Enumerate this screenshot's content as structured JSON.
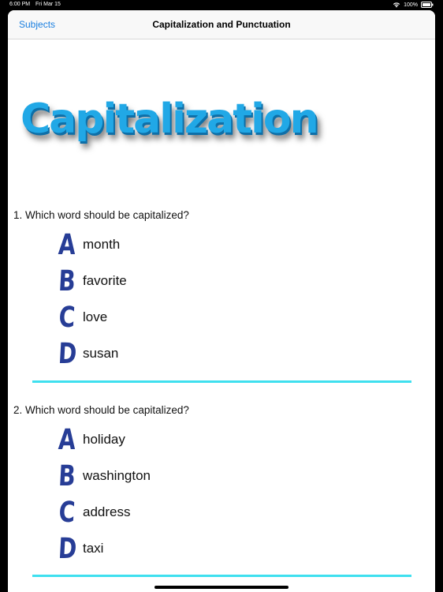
{
  "status_bar": {
    "time": "6:00 PM",
    "date": "Fri Mar 15",
    "battery": "100%"
  },
  "nav": {
    "back_label": "Subjects",
    "title": "Capitalization and Punctuation"
  },
  "hero": {
    "title": "Capitalization"
  },
  "questions": [
    {
      "text": "1. Which word should be capitalized?",
      "options": [
        {
          "letter": "A",
          "text": "month"
        },
        {
          "letter": "B",
          "text": "favorite"
        },
        {
          "letter": "C",
          "text": "love"
        },
        {
          "letter": "D",
          "text": "susan"
        }
      ]
    },
    {
      "text": "2. Which word should be capitalized?",
      "options": [
        {
          "letter": "A",
          "text": "holiday"
        },
        {
          "letter": "B",
          "text": "washington"
        },
        {
          "letter": "C",
          "text": "address"
        },
        {
          "letter": "D",
          "text": "taxi"
        }
      ]
    }
  ],
  "colors": {
    "accent_link": "#1a7fe0",
    "option_letter": "#273d96",
    "divider": "#3fe0ef",
    "hero_text": "#21a8e6"
  }
}
